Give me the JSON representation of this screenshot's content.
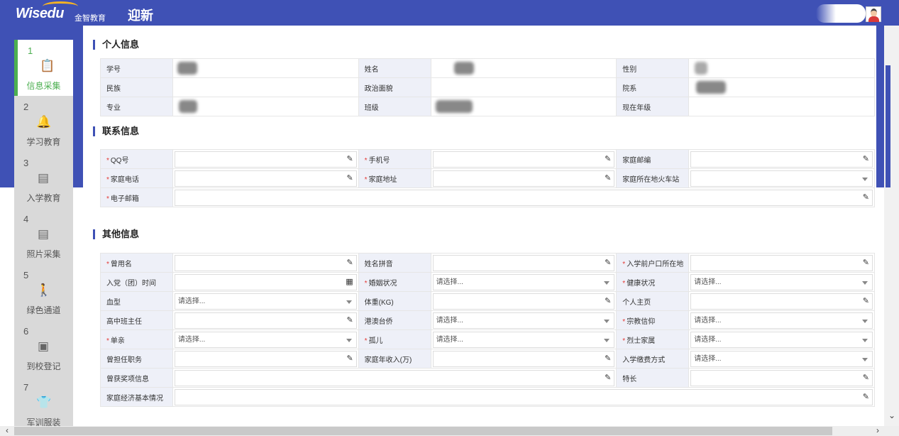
{
  "header": {
    "logo": "Wisedu",
    "logo_sub": "金智教育",
    "title": "迎新"
  },
  "steps": [
    {
      "num": "1",
      "label": "信息采集",
      "icon": "clipboard-icon",
      "active": true
    },
    {
      "num": "2",
      "label": "学习教育",
      "icon": "bell-icon"
    },
    {
      "num": "3",
      "label": "入学教育",
      "icon": "calendar-icon"
    },
    {
      "num": "4",
      "label": "照片采集",
      "icon": "calendar-icon"
    },
    {
      "num": "5",
      "label": "绿色通道",
      "icon": "walking-icon"
    },
    {
      "num": "6",
      "label": "到校登记",
      "icon": "badge-icon"
    },
    {
      "num": "7",
      "label": "军训服装",
      "icon": "tshirt-icon"
    }
  ],
  "personal": {
    "title": "个人信息",
    "labels": {
      "student_id": "学号",
      "name": "姓名",
      "gender": "性别",
      "ethnicity": "民族",
      "politics": "政治面貌",
      "college": "院系",
      "major": "专业",
      "class": "班级",
      "grade": "现在年级"
    }
  },
  "contact": {
    "title": "联系信息",
    "labels": {
      "qq": "QQ号",
      "mobile": "手机号",
      "postcode": "家庭邮编",
      "home_phone": "家庭电话",
      "home_address": "家庭地址",
      "station": "家庭所在地火车站",
      "email": "电子邮箱"
    }
  },
  "other": {
    "title": "其他信息",
    "placeholder": "请选择...",
    "labels": {
      "former_name": "曾用名",
      "name_pinyin": "姓名拼音",
      "hukou": "入学前户口所在地",
      "party_date": "入党（团）时间",
      "marital": "婚姻状况",
      "health": "健康状况",
      "blood": "血型",
      "weight": "体重(KG)",
      "homepage": "个人主页",
      "hs_teacher": "高中班主任",
      "hmt": "港澳台侨",
      "religion": "宗教信仰",
      "single_parent": "单亲",
      "orphan": "孤儿",
      "martyr": "烈士家属",
      "former_position": "曾担任职务",
      "family_income": "家庭年收入(万)",
      "payment": "入学缴费方式",
      "awards": "曾获奖项信息",
      "specialty": "特长",
      "economy": "家庭经济基本情况"
    }
  },
  "colors": {
    "primary": "#3f51b5",
    "active": "#4caf50",
    "required": "#e53935"
  }
}
